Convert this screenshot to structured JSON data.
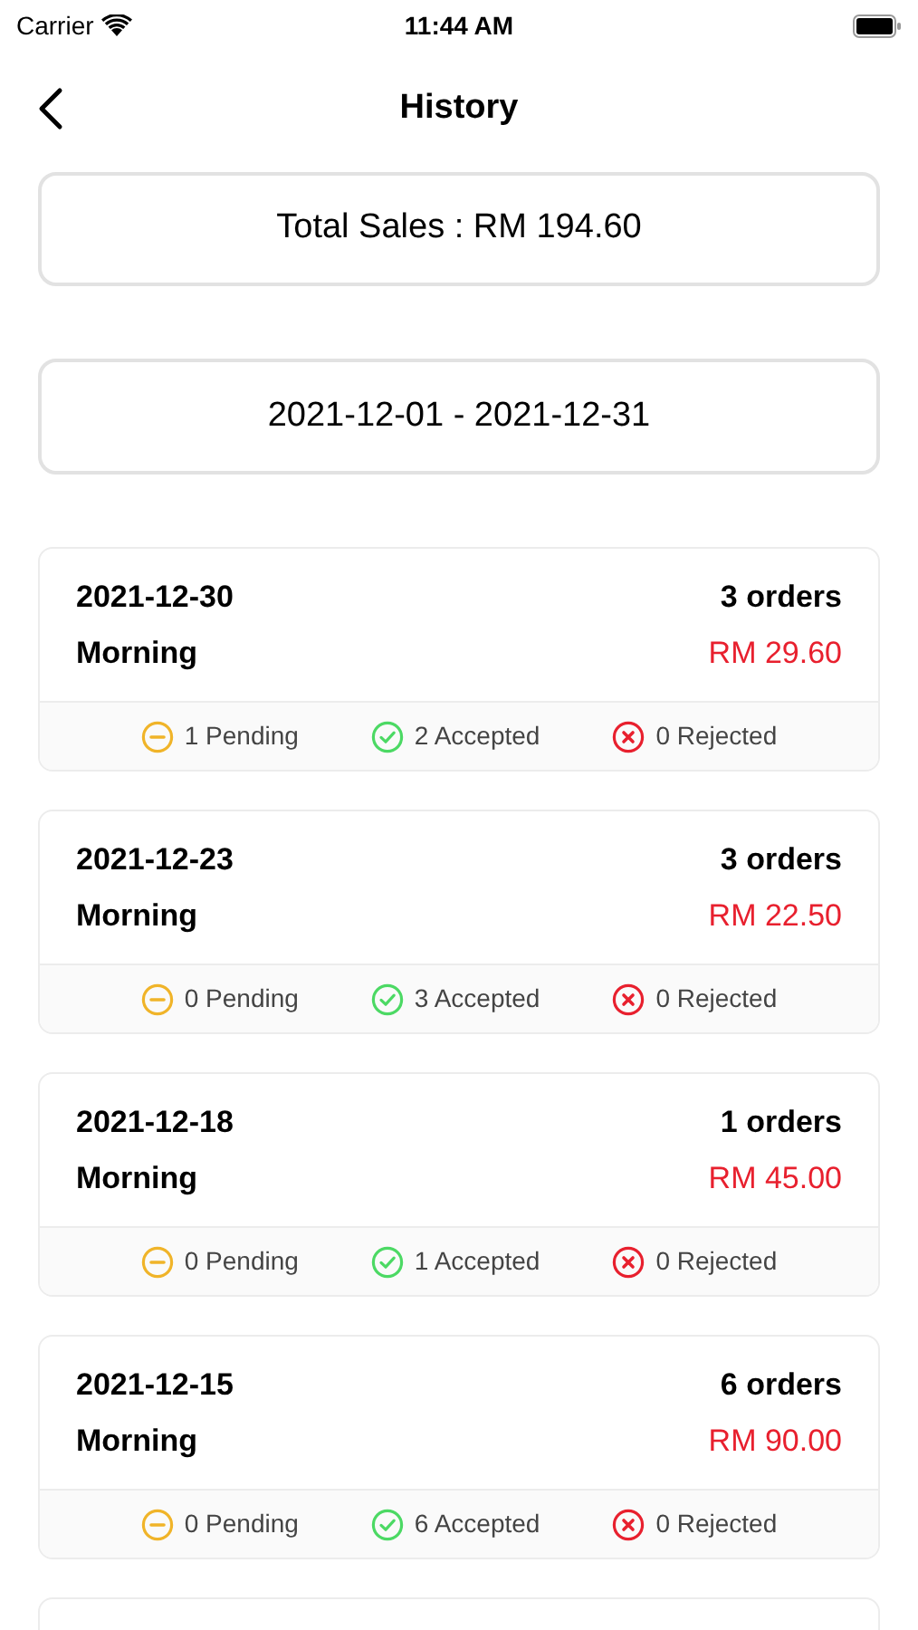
{
  "status_bar": {
    "carrier": "Carrier",
    "time": "11:44 AM"
  },
  "nav": {
    "title": "History"
  },
  "total_sales": "Total Sales : RM 194.60",
  "date_range": "2021-12-01 - 2021-12-31",
  "days": [
    {
      "date": "2021-12-30",
      "session": "Morning",
      "orders": "3 orders",
      "amount": "RM 29.60",
      "statuses": [
        {
          "kind": "pending",
          "label": "1 Pending"
        },
        {
          "kind": "accepted",
          "label": "2 Accepted"
        },
        {
          "kind": "rejected",
          "label": "0 Rejected"
        }
      ]
    },
    {
      "date": "2021-12-23",
      "session": "Morning",
      "orders": "3 orders",
      "amount": "RM 22.50",
      "statuses": [
        {
          "kind": "pending",
          "label": "0 Pending"
        },
        {
          "kind": "accepted",
          "label": "3 Accepted"
        },
        {
          "kind": "rejected",
          "label": "0 Rejected"
        }
      ]
    },
    {
      "date": "2021-12-18",
      "session": "Morning",
      "orders": "1 orders",
      "amount": "RM 45.00",
      "statuses": [
        {
          "kind": "pending",
          "label": "0 Pending"
        },
        {
          "kind": "accepted",
          "label": "1 Accepted"
        },
        {
          "kind": "rejected",
          "label": "0 Rejected"
        }
      ]
    },
    {
      "date": "2021-12-15",
      "session": "Morning",
      "orders": "6 orders",
      "amount": "RM 90.00",
      "statuses": [
        {
          "kind": "pending",
          "label": "0 Pending"
        },
        {
          "kind": "accepted",
          "label": "6 Accepted"
        },
        {
          "kind": "rejected",
          "label": "0 Rejected"
        }
      ]
    }
  ]
}
